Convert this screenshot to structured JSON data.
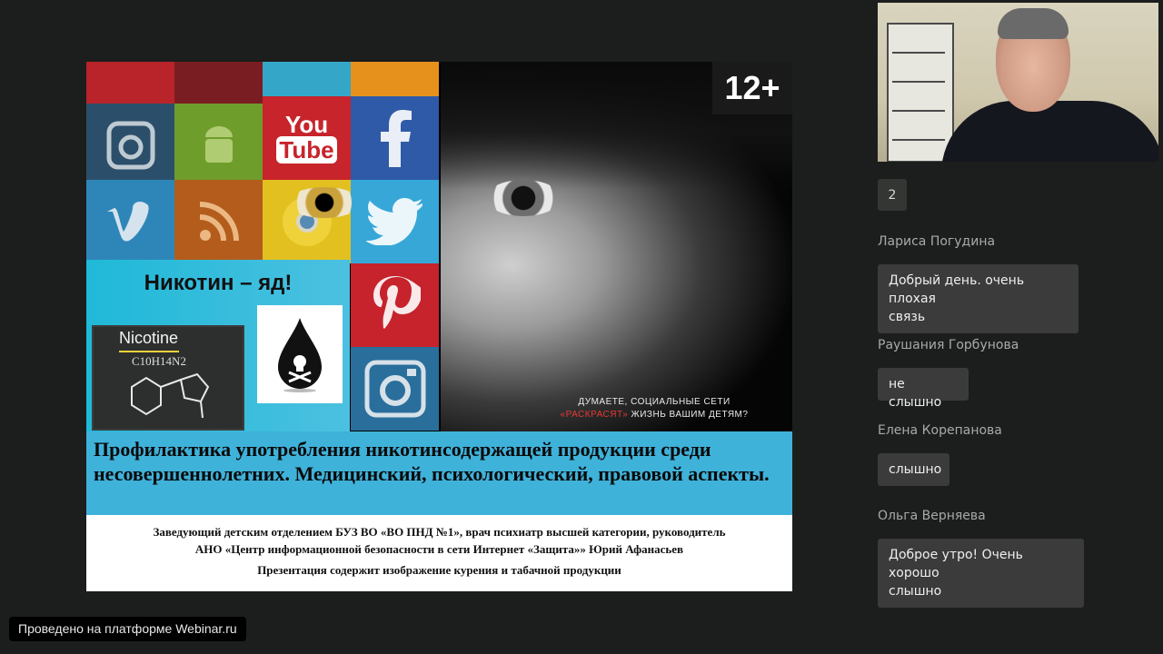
{
  "slide": {
    "age_badge": "12+",
    "tile_icons": [
      "pinterest-icon",
      "beats-icon",
      "vine-icon",
      "podcast-icon",
      "instagram-icon",
      "android-icon",
      "youtube-icon",
      "facebook-icon",
      "vimeo-icon",
      "rss-icon",
      "chrome-icon",
      "twitter-icon",
      "pinterest-icon",
      "instagram-icon"
    ],
    "youtube_label_1": "You",
    "youtube_label_2": "Tube",
    "nicotine_heading": "Никотин – яд!",
    "chalkboard_title": "Nicotine",
    "chalkboard_formula": "C10H14N2",
    "tagline_line1": "ДУМАЕТЕ, СОЦИАЛЬНЫЕ СЕТИ",
    "tagline_highlight": "«РАСКРАСЯТ»",
    "tagline_line2_rest": " ЖИЗНЬ ВАШИМ ДЕТЯМ?",
    "title": "Профилактика употребления никотинсодержащей продукции среди несовершеннолетних.  Медицинский, психологический, правовой аспекты.",
    "author_line1": "Заведующий детским отделением БУЗ ВО «ВО ПНД №1», врач психиатр высшей категории, руководитель",
    "author_line2": "АНО «Центр информационной безопасности в сети Интернет «Защита»» Юрий Афанасьев",
    "disclaimer": "Презентация содержит изображение курения и табачной продукции"
  },
  "platform_badge": "Проведено на платформе Webinar.ru",
  "participants_count": "2",
  "chat": [
    {
      "author": "Лариса Погудина",
      "message_line1": "Добрый день. очень плохая",
      "message_line2": "связь"
    },
    {
      "author": "Раушания Горбунова",
      "message_line1": "не слышно",
      "message_line2": ""
    },
    {
      "author": "Елена Корепанова",
      "message_line1": "слышно",
      "message_line2": ""
    },
    {
      "author": "Ольга Верняева",
      "message_line1": "Доброе утро!  Очень хорошо",
      "message_line2": "слышно"
    }
  ],
  "colors": {
    "background": "#1c1d1d",
    "slide_title_band": "#3fb2da",
    "chat_bubble": "#3a3b3a",
    "tagline_highlight": "#e53935"
  }
}
